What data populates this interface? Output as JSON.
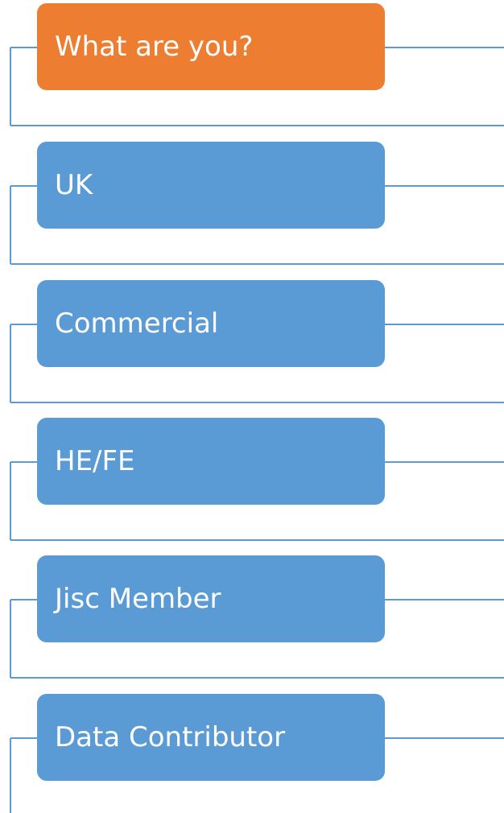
{
  "diagram": {
    "connector_color": "#5b9bd5",
    "steps": [
      {
        "label": "What are you?",
        "color": "#ed7d31",
        "highlighted": true
      },
      {
        "label": "UK",
        "color": "#5b9bd5",
        "highlighted": false
      },
      {
        "label": "Commercial",
        "color": "#5b9bd5",
        "highlighted": false
      },
      {
        "label": "HE/FE",
        "color": "#5b9bd5",
        "highlighted": false
      },
      {
        "label": "Jisc Member",
        "color": "#5b9bd5",
        "highlighted": false
      },
      {
        "label": "Data Contributor",
        "color": "#5b9bd5",
        "highlighted": false
      }
    ]
  }
}
